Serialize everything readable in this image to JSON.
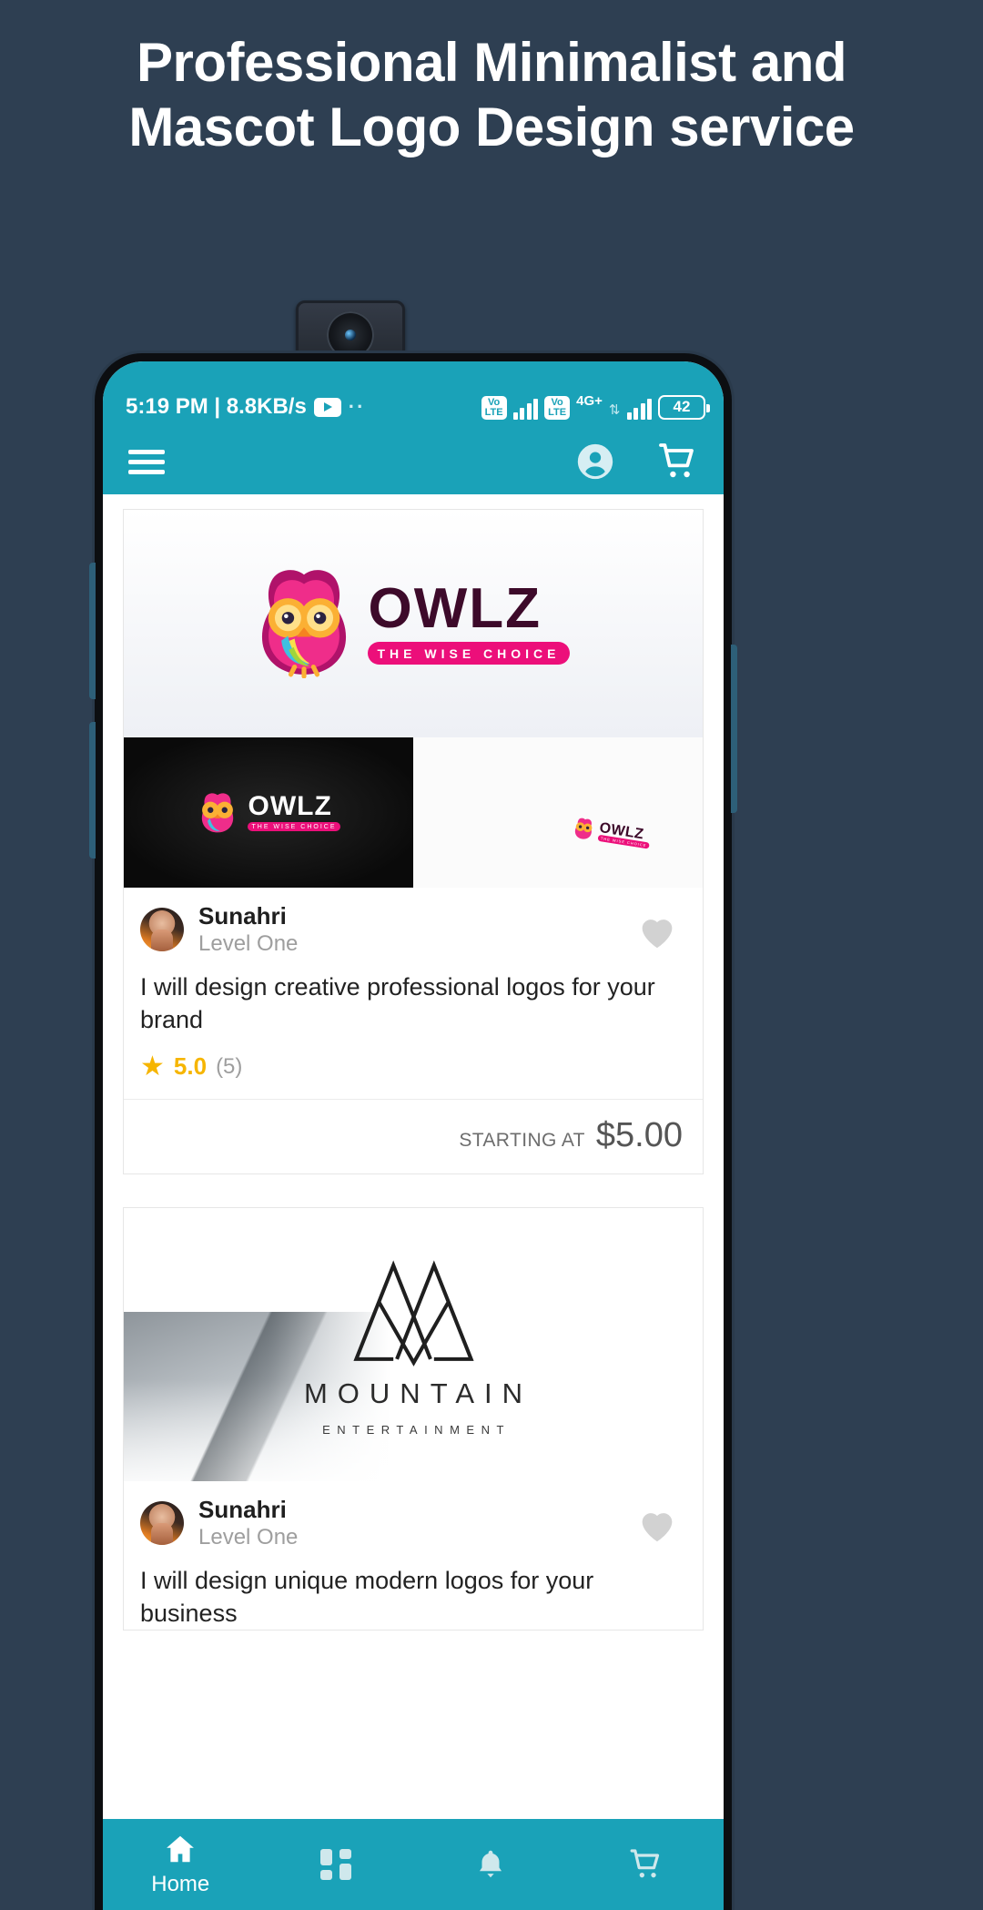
{
  "headline": {
    "line1": "Professional Minimalist and",
    "line2": "Mascot Logo Design service"
  },
  "statusbar": {
    "time_and_speed": "5:19 PM | 8.8KB/s",
    "media_icon": "youtube-icon",
    "notification_dots": "··",
    "volte_label_1": "Vo\nLTE",
    "volte_label_2": "Vo\nLTE",
    "network_type": "4G+",
    "data_arrows": "⇅",
    "battery_level": "42"
  },
  "appbar": {
    "menu_icon": "hamburger-menu-icon",
    "account_icon": "account-circle-icon",
    "cart_icon": "shopping-cart-icon",
    "background_color": "#1aa2b8"
  },
  "gigs": [
    {
      "media_type": "owlz-logo-showcase",
      "logo_word": "OWLZ",
      "logo_tagline": "THE WISE CHOICE",
      "seller_name": "Sunahri",
      "seller_level": "Level One",
      "favorite_icon": "heart-icon",
      "title": "I will design creative professional logos for your brand",
      "star_icon": "★",
      "rating": "5.0",
      "review_count": "(5)",
      "price_label": "STARTING AT",
      "price_value": "$5.00"
    },
    {
      "media_type": "mountain-logo-showcase",
      "logo_word": "MOUNTAIN",
      "logo_tagline": "ENTERTAINMENT",
      "seller_name": "Sunahri",
      "seller_level": "Level One",
      "favorite_icon": "heart-icon",
      "title": "I will design unique modern logos for your business"
    }
  ],
  "bottomnav": {
    "items": [
      {
        "icon": "home-icon",
        "label": "Home",
        "active": true
      },
      {
        "icon": "categories-grid-icon",
        "label": ""
      },
      {
        "icon": "bell-icon",
        "label": ""
      },
      {
        "icon": "cart-icon",
        "label": ""
      }
    ]
  },
  "colors": {
    "page_background": "#2e3f52",
    "accent": "#1aa2b8",
    "star": "#f6b500",
    "brand_pink": "#ec0f7a"
  }
}
